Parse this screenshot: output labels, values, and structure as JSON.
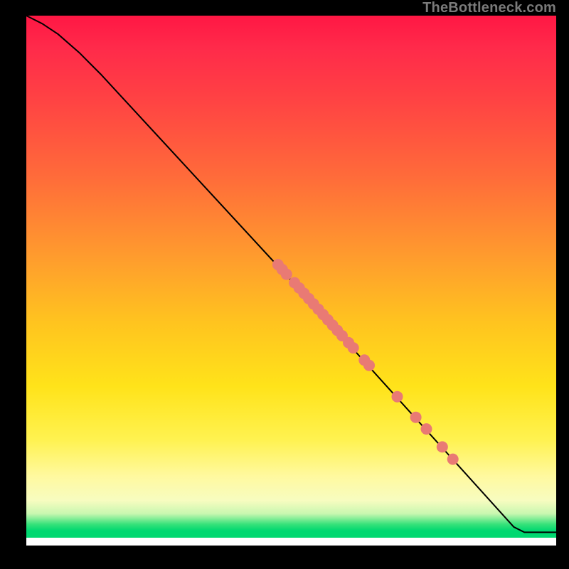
{
  "watermark": "TheBottleneck.com",
  "colors": {
    "point_fill": "#e97a74",
    "curve_stroke": "#000000"
  },
  "chart_data": {
    "type": "line",
    "title": "",
    "xlabel": "",
    "ylabel": "",
    "xlim": [
      0,
      100
    ],
    "ylim": [
      0,
      100
    ],
    "grid": false,
    "legend": false,
    "curve": [
      {
        "x": 0.0,
        "y": 100.0
      },
      {
        "x": 3.0,
        "y": 98.5
      },
      {
        "x": 6.0,
        "y": 96.5
      },
      {
        "x": 10.0,
        "y": 93.0
      },
      {
        "x": 14.0,
        "y": 89.0
      },
      {
        "x": 50.0,
        "y": 50.0
      },
      {
        "x": 92.0,
        "y": 3.5
      },
      {
        "x": 94.0,
        "y": 2.5
      },
      {
        "x": 100.0,
        "y": 2.5
      }
    ],
    "points": [
      {
        "x": 47.5,
        "y": 53.0
      },
      {
        "x": 48.3,
        "y": 52.1
      },
      {
        "x": 49.1,
        "y": 51.2
      },
      {
        "x": 50.6,
        "y": 49.6
      },
      {
        "x": 51.5,
        "y": 48.6
      },
      {
        "x": 52.4,
        "y": 47.6
      },
      {
        "x": 53.3,
        "y": 46.6
      },
      {
        "x": 54.2,
        "y": 45.6
      },
      {
        "x": 55.1,
        "y": 44.6
      },
      {
        "x": 56.0,
        "y": 43.6
      },
      {
        "x": 56.9,
        "y": 42.6
      },
      {
        "x": 57.8,
        "y": 41.6
      },
      {
        "x": 58.7,
        "y": 40.6
      },
      {
        "x": 59.6,
        "y": 39.6
      },
      {
        "x": 60.8,
        "y": 38.3
      },
      {
        "x": 61.7,
        "y": 37.3
      },
      {
        "x": 63.8,
        "y": 35.0
      },
      {
        "x": 64.7,
        "y": 34.0
      },
      {
        "x": 70.0,
        "y": 28.1
      },
      {
        "x": 73.5,
        "y": 24.2
      },
      {
        "x": 75.5,
        "y": 22.0
      },
      {
        "x": 78.5,
        "y": 18.6
      },
      {
        "x": 80.5,
        "y": 16.3
      }
    ]
  }
}
